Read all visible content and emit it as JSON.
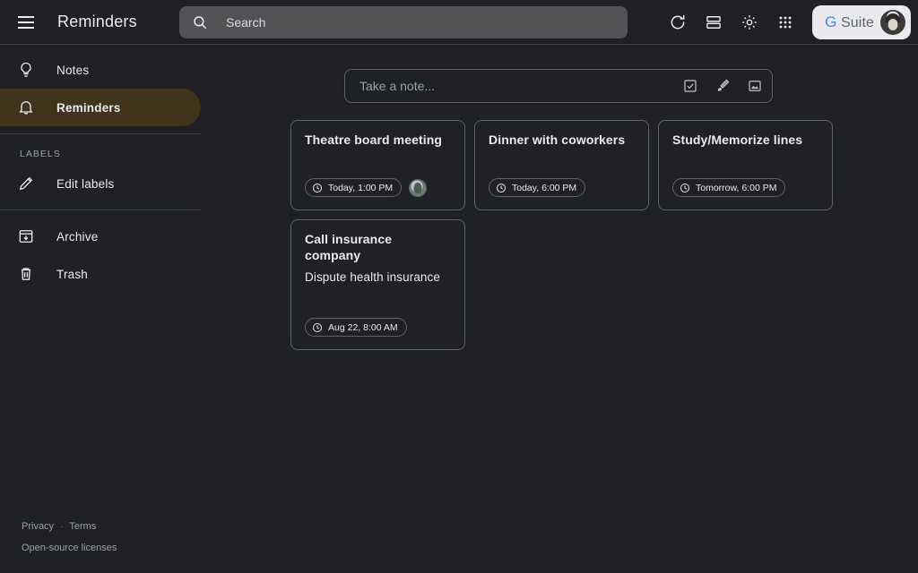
{
  "header": {
    "menu_icon": "hamburger-icon",
    "title": "Reminders",
    "search": {
      "placeholder": "Search",
      "value": "",
      "icon": "search-icon"
    },
    "actions": [
      {
        "name": "refresh-button",
        "icon": "refresh-icon"
      },
      {
        "name": "list-view-button",
        "icon": "list-view-icon"
      },
      {
        "name": "settings-button",
        "icon": "gear-icon"
      },
      {
        "name": "apps-button",
        "icon": "apps-grid-icon"
      }
    ],
    "account": {
      "brand_g": "G",
      "brand_rest": " Suite",
      "avatar": "user-avatar"
    }
  },
  "sidebar": {
    "items": [
      {
        "label": "Notes",
        "icon": "lightbulb-icon",
        "active": false
      },
      {
        "label": "Reminders",
        "icon": "bell-icon",
        "active": true
      }
    ],
    "labels_heading": "LABELS",
    "edit_labels": {
      "label": "Edit labels",
      "icon": "pencil-icon"
    },
    "bottom_items": [
      {
        "label": "Archive",
        "icon": "archive-icon"
      },
      {
        "label": "Trash",
        "icon": "trash-icon"
      }
    ]
  },
  "footer": {
    "privacy": "Privacy",
    "separator": "·",
    "terms": "Terms",
    "licenses": "Open-source licenses"
  },
  "take_note": {
    "placeholder": "Take a note...",
    "value": "",
    "actions": [
      {
        "name": "new-list-button",
        "icon": "checkbox-icon"
      },
      {
        "name": "new-drawing-button",
        "icon": "brush-icon"
      },
      {
        "name": "new-image-note-button",
        "icon": "image-icon"
      }
    ]
  },
  "notes": [
    {
      "title": "Theatre board meeting",
      "body": "",
      "reminder": "Today, 1:00 PM",
      "has_collaborator": true
    },
    {
      "title": "Dinner with coworkers",
      "body": "",
      "reminder": "Today, 6:00 PM",
      "has_collaborator": false
    },
    {
      "title": "Study/Memorize lines",
      "body": "",
      "reminder": "Tomorrow, 6:00 PM",
      "has_collaborator": false
    },
    {
      "title": "Call insurance company",
      "body": "Dispute health insurance",
      "reminder": "Aug 22, 8:00 AM",
      "has_collaborator": false
    }
  ],
  "colors": {
    "page_background": "#202124",
    "active_nav": "#41331c",
    "search_background": "#525355",
    "border": "#5f6368",
    "text_primary": "#e8eaed",
    "text_secondary": "#9aa0a6",
    "accent_blue": "#4285f4"
  }
}
